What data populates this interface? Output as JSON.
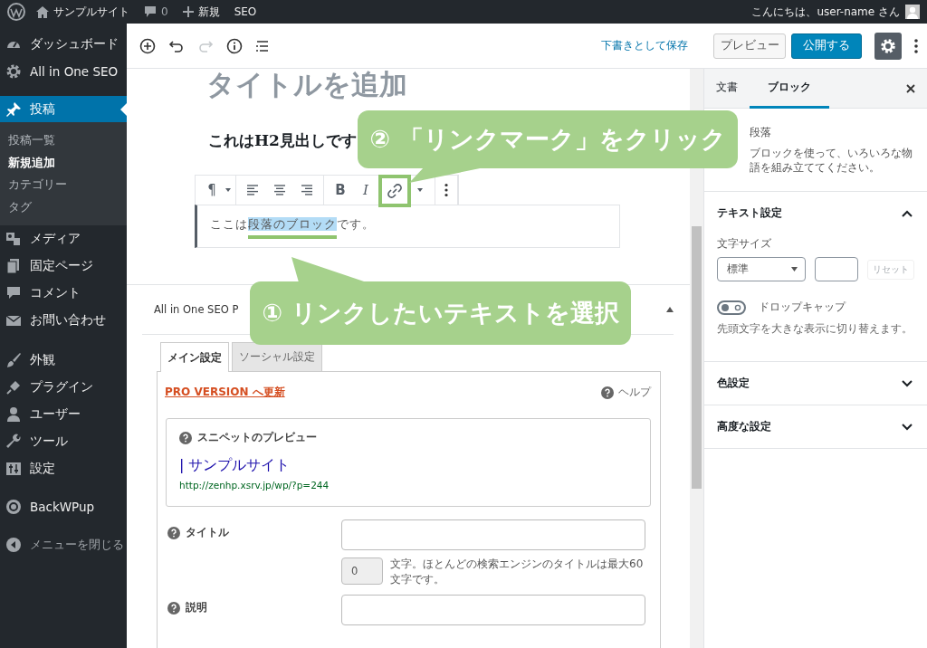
{
  "admin_bar": {
    "site_name": "サンプルサイト",
    "comments": "0",
    "new": "新規",
    "seo": "SEO",
    "greeting": "こんにちは、user-name さん"
  },
  "menu": {
    "groups": [
      [
        {
          "label": "ダッシュボード",
          "selected": false
        },
        {
          "label": "All in One SEO",
          "selected": false
        }
      ],
      [
        {
          "label": "投稿",
          "selected": true,
          "children": [
            {
              "label": "投稿一覧",
              "selected": false
            },
            {
              "label": "新規追加",
              "selected": true
            },
            {
              "label": "カテゴリー",
              "selected": false
            },
            {
              "label": "タグ",
              "selected": false
            }
          ]
        },
        {
          "label": "メディア",
          "selected": false
        },
        {
          "label": "固定ページ",
          "selected": false
        },
        {
          "label": "コメント",
          "selected": false
        },
        {
          "label": "お問い合わせ",
          "selected": false
        }
      ],
      [
        {
          "label": "外観",
          "selected": false
        },
        {
          "label": "プラグイン",
          "selected": false
        },
        {
          "label": "ユーザー",
          "selected": false
        },
        {
          "label": "ツール",
          "selected": false
        },
        {
          "label": "設定",
          "selected": false
        }
      ],
      [
        {
          "label": "BackWPup",
          "selected": false
        }
      ]
    ],
    "collapse": "メニューを閉じる"
  },
  "header": {
    "redo_disabled": true,
    "save_draft": "下書きとして保存",
    "preview": "プレビュー",
    "publish": "公開する",
    "settings_open": true
  },
  "post": {
    "title_placeholder": "タイトルを追加",
    "heading": "これはH2見出しです",
    "toolbar": {
      "paragraph": "¶",
      "bold": "B",
      "italic": "I",
      "link_highlighted": true
    },
    "paragraph": {
      "before": "ここは",
      "selected": "段落のブロック",
      "after": "です。"
    }
  },
  "seo": {
    "title": "All in One SEO P",
    "tabs": [
      {
        "label": "メイン設定",
        "selected": true
      },
      {
        "label": "ソーシャル設定",
        "selected": false
      }
    ],
    "upgrade_link": "PRO VERSION へ更新",
    "help": "ヘルプ",
    "snippet": {
      "heading": "スニペットのプレビュー",
      "title": "| サンプルサイト",
      "url": "http://zenhp.xsrv.jp/wp/?p=244"
    },
    "fields": [
      {
        "label": "タイトル",
        "counter": "0",
        "note": "文字。ほとんどの検索エンジンのタイトルは最大60文字です。"
      },
      {
        "label": "説明"
      }
    ]
  },
  "inspector": {
    "tabs": [
      {
        "label": "文書",
        "selected": false
      },
      {
        "label": "ブロック",
        "selected": true
      }
    ],
    "block": {
      "name": "段落",
      "description": "ブロックを使って、いろいろな物語を組み立ててください。"
    },
    "panels": [
      {
        "title": "テキスト設定",
        "expanded": true,
        "body": {
          "size_label": "文字サイズ",
          "size_value": "標準",
          "reset": "リセット",
          "reset_disabled": true,
          "drop_cap": {
            "label": "ドロップキャップ",
            "on": false
          },
          "help": "先頭文字を大きな表示に切り替えます。"
        }
      },
      {
        "title": "色設定",
        "expanded": false
      },
      {
        "title": "高度な設定",
        "expanded": false
      }
    ]
  },
  "callouts": [
    {
      "text": "② 「リンクマーク」をクリック"
    },
    {
      "text": "① リンクしたいテキストを選択"
    }
  ]
}
